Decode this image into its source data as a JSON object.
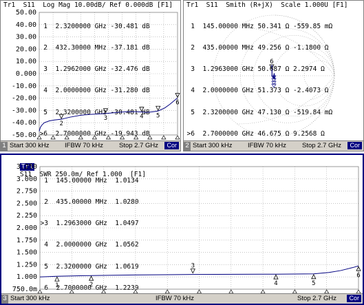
{
  "panel1": {
    "title": "Tr1  S11  Log Mag 10.00dB/ Ref 0.000dB [F1]",
    "markers": [
      {
        "id": "1",
        "stimulus": "2.3200000 GHz",
        "value": "-30.481 dB"
      },
      {
        "id": "2",
        "stimulus": "432.30000 MHz",
        "value": "-37.181 dB"
      },
      {
        "id": "3",
        "stimulus": "1.2962000 GHz",
        "value": "-32.476 dB"
      },
      {
        "id": "4",
        "stimulus": "2.0000000 GHz",
        "value": "-31.280 dB"
      },
      {
        "id": "5",
        "stimulus": "2.3200000 GHz",
        "value": "-30.481 dB"
      },
      {
        "id": ">6",
        "stimulus": "2.7000000 GHz",
        "value": "-19.943 dB"
      }
    ],
    "y_ticks": [
      "50.00",
      "40.00",
      "30.00",
      "20.00",
      "10.00",
      "0.000",
      "-10.00",
      "-20.00",
      "-30.00",
      "-40.00",
      "-50.00"
    ],
    "status": {
      "channel": "1",
      "start": "Start 300 kHz",
      "ifbw": "IFBW 70 kHz",
      "stop": "Stop 2.7 GHz",
      "cor": "Cor"
    }
  },
  "panel2": {
    "title": "Tr1  S11  Smith (R+jX)  Scale 1.000U [F1]",
    "markers": [
      {
        "id": "1",
        "stimulus": "145.00000 MHz",
        "real": "50.341 Ω",
        "imag": "-559.85 mΩ"
      },
      {
        "id": "2",
        "stimulus": "435.00000 MHz",
        "real": "49.256 Ω",
        "imag": "-1.1800 Ω"
      },
      {
        "id": "3",
        "stimulus": "1.2963000 GHz",
        "real": "50.687 Ω",
        "imag": "2.2974 Ω"
      },
      {
        "id": "4",
        "stimulus": "2.0000000 GHz",
        "real": "51.373 Ω",
        "imag": "-2.4073 Ω"
      },
      {
        "id": "5",
        "stimulus": "2.3200000 GHz",
        "real": "47.130 Ω",
        "imag": "-519.84 mΩ"
      },
      {
        "id": ">6",
        "stimulus": "2.7000000 GHz",
        "real": "46.675 Ω",
        "imag": "9.2568 Ω"
      }
    ],
    "status": {
      "channel": "2",
      "start": "Start 300 kHz",
      "ifbw": "IFBW 70 kHz",
      "stop": "Stop 2.7 GHz",
      "cor": "Cor"
    }
  },
  "panel3": {
    "trace_tag": "Tr1",
    "title": "S11  SWR 250.0m/ Ref 1.000  [F1]",
    "markers": [
      {
        "id": "1",
        "stimulus": "145.00000 MHz",
        "value": "1.0134"
      },
      {
        "id": "2",
        "stimulus": "435.00000 MHz",
        "value": "1.0280"
      },
      {
        "id": ">3",
        "stimulus": "1.2963000 GHz",
        "value": "1.0497"
      },
      {
        "id": "4",
        "stimulus": "2.0000000 GHz",
        "value": "1.0562"
      },
      {
        "id": "5",
        "stimulus": "2.3200000 GHz",
        "value": "1.0619"
      },
      {
        "id": "6",
        "stimulus": "2.7000000 GHz",
        "value": "1.2239"
      }
    ],
    "y_ticks": [
      "3.250",
      "3.000",
      "2.750",
      "2.500",
      "2.250",
      "2.000",
      "1.750",
      "1.500",
      "1.250",
      "1.000",
      "750.0m"
    ],
    "status": {
      "channel": "3",
      "start": "Start 300 kHz",
      "ifbw": "IFBW 70 kHz",
      "stop": "Stop 2.7 GHz",
      "cor": "Cor"
    }
  },
  "colors": {
    "trace": "#000080",
    "status_bg": "#d4d0c8",
    "cor_bg": "#000080"
  }
}
